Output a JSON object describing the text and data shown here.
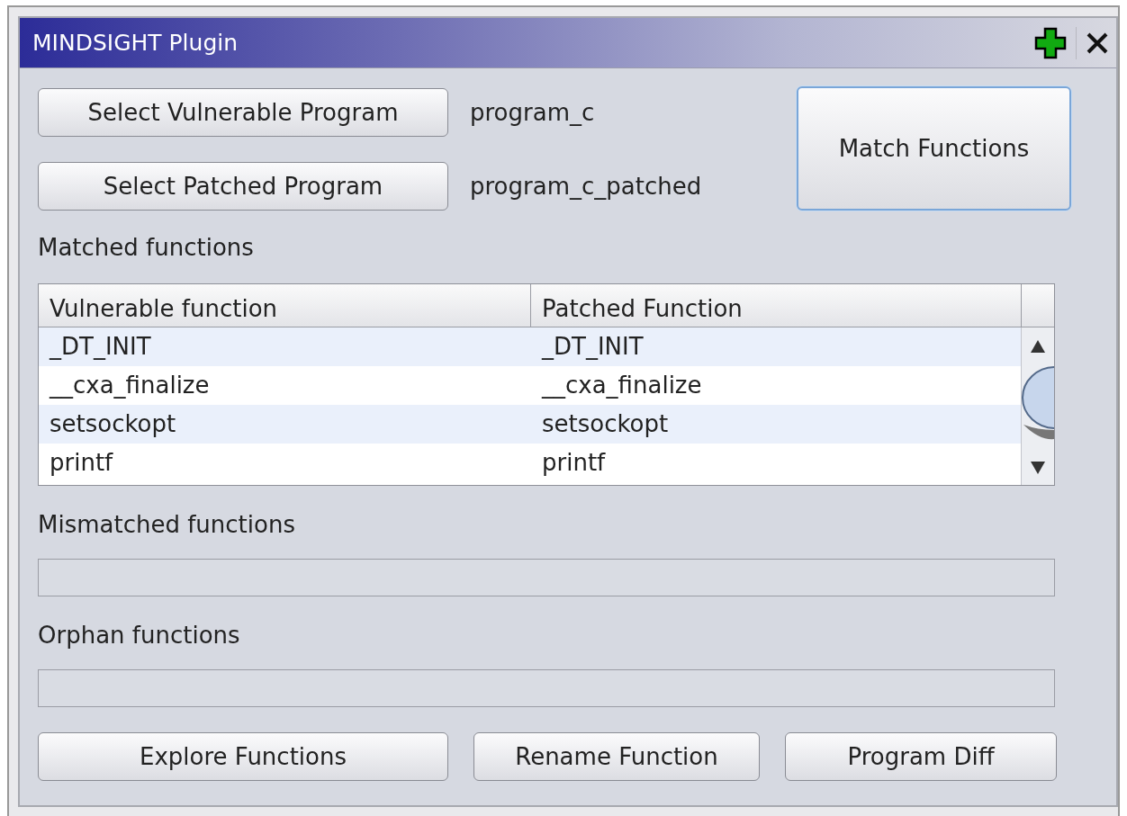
{
  "window": {
    "title": "MINDSIGHT Plugin"
  },
  "selectors": [
    {
      "button": "Select Vulnerable Program",
      "value": "program_c"
    },
    {
      "button": "Select Patched Program",
      "value": "program_c_patched"
    }
  ],
  "match_button": {
    "label": "Match Functions",
    "focused": true
  },
  "matched": {
    "label": "Matched functions",
    "columns": [
      "Vulnerable function",
      "Patched Function"
    ],
    "rows": [
      [
        "_DT_INIT",
        "_DT_INIT"
      ],
      [
        "__cxa_finalize",
        "__cxa_finalize"
      ],
      [
        "setsockopt",
        "setsockopt"
      ],
      [
        "printf",
        "printf"
      ]
    ]
  },
  "mismatched": {
    "label": "Mismatched functions"
  },
  "orphan": {
    "label": "Orphan functions"
  },
  "buttons": [
    "Explore Functions",
    "Rename Function",
    "Program Diff"
  ]
}
